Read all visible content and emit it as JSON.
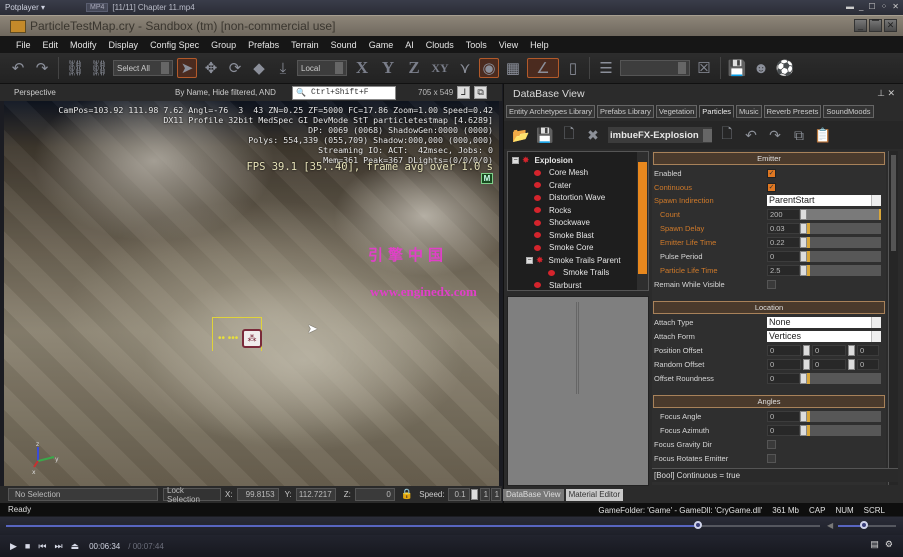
{
  "potplayer": {
    "logo": "Potplayer ▾",
    "format": "MP4",
    "title": "[11/11] Chapter 11.mp4"
  },
  "window": {
    "title": "ParticleTestMap.cry - Sandbox (tm) [non-commercial use]"
  },
  "menu": [
    "File",
    "Edit",
    "Modify",
    "Display",
    "Config Spec",
    "Group",
    "Prefabs",
    "Terrain",
    "Sound",
    "Game",
    "AI",
    "Clouds",
    "Tools",
    "View",
    "Help"
  ],
  "toolbar": {
    "select_filter": "Select All",
    "coord_system": "Local",
    "axis_x": "X",
    "axis_y": "Y",
    "axis_z": "Z",
    "axis_xy": "XY"
  },
  "viewport": {
    "mode": "Perspective",
    "filter_text": "By Name, Hide filtered, AND",
    "search_placeholder": "Ctrl+Shift+F",
    "resolution": "705 x 549",
    "hud_lines": [
      "CamPos=103.92 111.98 7.62 Angl=-76  3  43 ZN=0.25 ZF=5000 FC=17.86 Zoom=1.00 Speed=0.42",
      "DX11 Profile 32bit MedSpec GI DevMode StT particletestmap [4.6289]",
      "DP: 0069 (0068) ShadowGen:0000 (0000)",
      "Polys: 554,339 (055,709) Shadow:000,000 (000,000)",
      "Streaming IO: ACT:  42msec, Jobs: 0",
      "Mem=361 Peak=367 DLights=(0/0/0/0)"
    ],
    "fps_line": "FPS 39.1 [35..40], frame avg over 1.0 s",
    "mode_badge": "M",
    "watermark_cn": "引擎中国",
    "watermark_url": "www.enginedx.com",
    "axis_labels": {
      "z": "z",
      "y": "y",
      "x": "x"
    }
  },
  "viewport_status": {
    "selection": "No Selection",
    "lock_button": "Lock Selection",
    "x_label": "X:",
    "x_value": "99.8153",
    "y_label": "Y:",
    "y_value": "112.7217",
    "z_label": "Z:",
    "z_value": "0",
    "speed_label": "Speed:",
    "speed_value": "0.1",
    "speed_presets": [
      "1",
      "1"
    ]
  },
  "status_bar": {
    "left": "Ready",
    "game_folder": "GameFolder: 'Game' - GameDll: 'CryGame.dll'",
    "memory": "361 Mb",
    "cap": "CAP",
    "num": "NUM",
    "scrl": "SCRL"
  },
  "database": {
    "title": "DataBase View",
    "tabs": [
      "Entity Archetypes Library",
      "Prefabs Library",
      "Vegetation",
      "Particles",
      "Music",
      "Reverb Presets",
      "SoundMoods"
    ],
    "active_tab": "Particles",
    "library": "imbueFX-Explosion",
    "tree": [
      {
        "label": "Explosion",
        "level": 0,
        "expanded": true,
        "type": "group"
      },
      {
        "label": "Core Mesh",
        "level": 1
      },
      {
        "label": "Crater",
        "level": 1
      },
      {
        "label": "Distortion Wave",
        "level": 1
      },
      {
        "label": "Rocks",
        "level": 1
      },
      {
        "label": "Shockwave",
        "level": 1
      },
      {
        "label": "Smoke Blast",
        "level": 1
      },
      {
        "label": "Smoke Core",
        "level": 1
      },
      {
        "label": "Smoke Trails Parent",
        "level": 1,
        "expanded": true,
        "type": "group"
      },
      {
        "label": "Smoke Trails",
        "level": 2
      },
      {
        "label": "Starburst",
        "level": 1
      }
    ],
    "sections": {
      "emitter": {
        "title": "Emitter",
        "enabled": {
          "label": "Enabled",
          "value": true
        },
        "continuous": {
          "label": "Continuous",
          "value": true
        },
        "spawn_indirection": {
          "label": "Spawn Indirection",
          "value": "ParentStart"
        },
        "count": {
          "label": "Count",
          "value": "200",
          "fill": 1.0
        },
        "spawn_delay": {
          "label": "Spawn Delay",
          "value": "0.03"
        },
        "emitter_life_time": {
          "label": "Emitter Life Time",
          "value": "0.22"
        },
        "pulse_period": {
          "label": "Pulse Period",
          "value": "0"
        },
        "particle_life_time": {
          "label": "Particle Life Time",
          "value": "2.5"
        },
        "remain_while_visible": {
          "label": "Remain While Visible",
          "value": false
        }
      },
      "location": {
        "title": "Location",
        "attach_type": {
          "label": "Attach Type",
          "value": "None"
        },
        "attach_form": {
          "label": "Attach Form",
          "value": "Vertices"
        },
        "position_offset": {
          "label": "Position Offset",
          "values": [
            "0",
            "0",
            "0"
          ]
        },
        "random_offset": {
          "label": "Random Offset",
          "values": [
            "0",
            "0",
            "0"
          ]
        },
        "offset_roundness": {
          "label": "Offset Roundness",
          "value": "0"
        }
      },
      "angles": {
        "title": "Angles",
        "focus_angle": {
          "label": "Focus Angle",
          "value": "0"
        },
        "focus_azimuth": {
          "label": "Focus Azimuth",
          "value": "0"
        },
        "focus_gravity_dir": {
          "label": "Focus Gravity Dir",
          "value": false
        },
        "focus_rotates_emitter": {
          "label": "Focus Rotates Emitter",
          "value": false
        }
      }
    },
    "property_status": "[Bool] Continuous = true",
    "bottom_tabs": [
      "DataBase View",
      "Material Editor"
    ]
  },
  "player": {
    "current_time": "00:06:34",
    "total_time": "00:07:44",
    "progress": 0.85,
    "volume": 0.45,
    "accent": "#5865c0"
  }
}
